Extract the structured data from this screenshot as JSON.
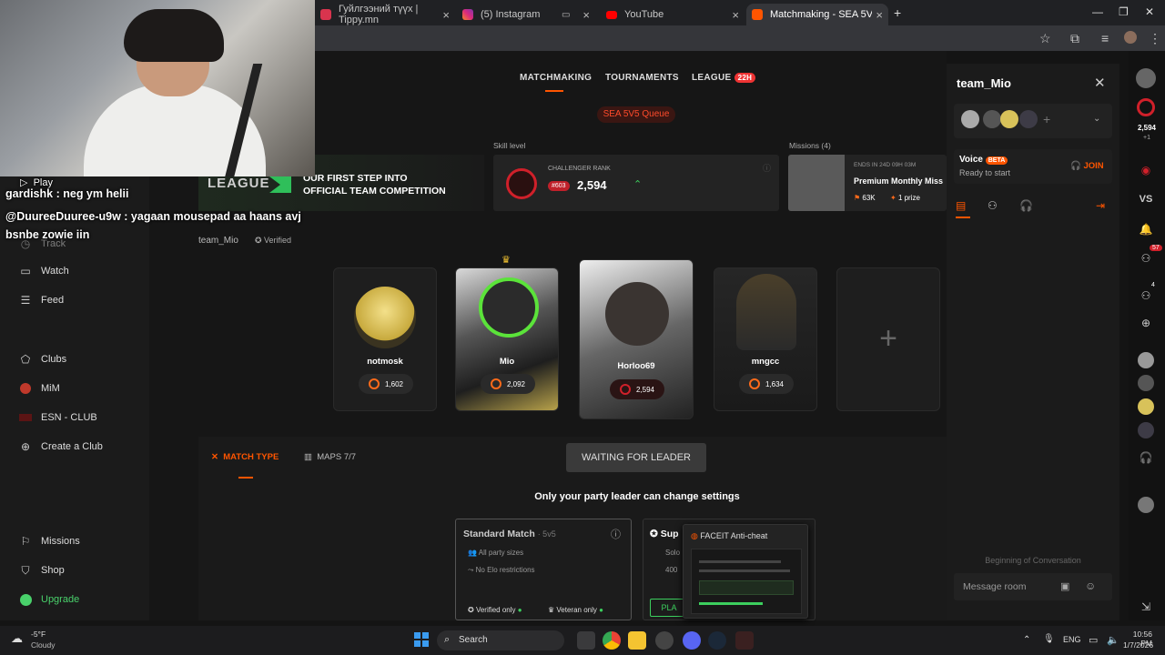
{
  "browser": {
    "tabs": [
      {
        "label": "Гуйлгээний түүх | Tippy.mn",
        "active": false
      },
      {
        "label": "(5) Instagram",
        "active": false
      },
      {
        "label": "YouTube",
        "active": false
      },
      {
        "label": "Matchmaking - SEA 5V5 Queue",
        "active": true
      }
    ]
  },
  "nav": {
    "matchmaking": "MATCHMAKING",
    "tournaments": "TOURNAMENTS",
    "league": "LEAGUE",
    "league_badge": "22H",
    "queue": "SEA 5V5 Queue"
  },
  "banner": {
    "logo_text": "LEAGUE",
    "line1": "OUR FIRST STEP INTO",
    "line2": "OFFICIAL TEAM COMPETITION"
  },
  "skill": {
    "label": "Skill level",
    "rank_label": "CHALLENGER RANK",
    "rank_badge": "#603",
    "elo": "2,594"
  },
  "missions": {
    "label": "Missions (4)",
    "ends": "ENDS IN 24D 09H 03M",
    "title": "Premium Monthly Miss",
    "points": "63K",
    "prize": "1 prize"
  },
  "team": {
    "name": "team_Mio",
    "verified": "Verified"
  },
  "chat_overlay": [
    {
      "user": "Play",
      "text": ""
    },
    {
      "user": "gardishk",
      "text": ": neg ym helii"
    },
    {
      "user": "@DuureeDuuree-u9w",
      "text": ": yagaan mousepad aa haans avj"
    },
    {
      "user": "",
      "text": "bsnbe zowie iin"
    }
  ],
  "sidebar": {
    "items": [
      {
        "label": "Track",
        "icon": "track-icon"
      },
      {
        "label": "Watch",
        "icon": "watch-icon"
      },
      {
        "label": "Feed",
        "icon": "feed-icon"
      },
      {
        "label": "Clubs",
        "icon": "clubs-icon"
      },
      {
        "label": "MiM",
        "icon": "mim-icon"
      },
      {
        "label": "ESN - CLUB",
        "icon": "esn-icon"
      },
      {
        "label": "Create a Club",
        "icon": "plus-circle-icon"
      },
      {
        "label": "Missions",
        "icon": "missions-icon"
      },
      {
        "label": "Shop",
        "icon": "shop-icon"
      },
      {
        "label": "Upgrade",
        "icon": "upgrade-icon"
      }
    ]
  },
  "players": [
    {
      "name": "notmosk",
      "elo": "1,602"
    },
    {
      "name": "Mio",
      "elo": "2,092"
    },
    {
      "name": "Horloo69",
      "elo": "2,594"
    },
    {
      "name": "mngcc",
      "elo": "1,634"
    }
  ],
  "match": {
    "match_type": "MATCH TYPE",
    "maps": "MAPS 7/7",
    "waiting": "WAITING FOR LEADER",
    "notice": "Only your party leader can change settings",
    "standard_title": "Standard Match",
    "standard_mode": "· 5v5",
    "all_party": "All party sizes",
    "no_elo": "No Elo restrictions",
    "verified_only": "Verified only",
    "veteran_only": "Veteran only",
    "super_title": "Sup",
    "solo": "Solo",
    "four_hundred": "400",
    "play": "PLA"
  },
  "popup": {
    "title": "FACEIT Anti-cheat"
  },
  "right_panel": {
    "title": "team_Mio",
    "voice": "Voice",
    "voice_badge": "BETA",
    "voice_status": "Ready to start",
    "join": "JOIN",
    "beginning": "Beginning of Conversation",
    "message_placeholder": "Message room"
  },
  "right_strip": {
    "elo": "2,594",
    "elo_delta": "+1",
    "vs": "VS",
    "badge1": "57",
    "badge2": "4"
  },
  "taskbar": {
    "weather_temp": "-5°F",
    "weather_desc": "Cloudy",
    "search": "Search",
    "lang": "ENG",
    "time": "10:56 PM",
    "date": "1/7/2026"
  },
  "colors": {
    "accent": "#ff5500",
    "verified_green": "#3ccf5e",
    "upgrade_green": "#49d16b"
  }
}
